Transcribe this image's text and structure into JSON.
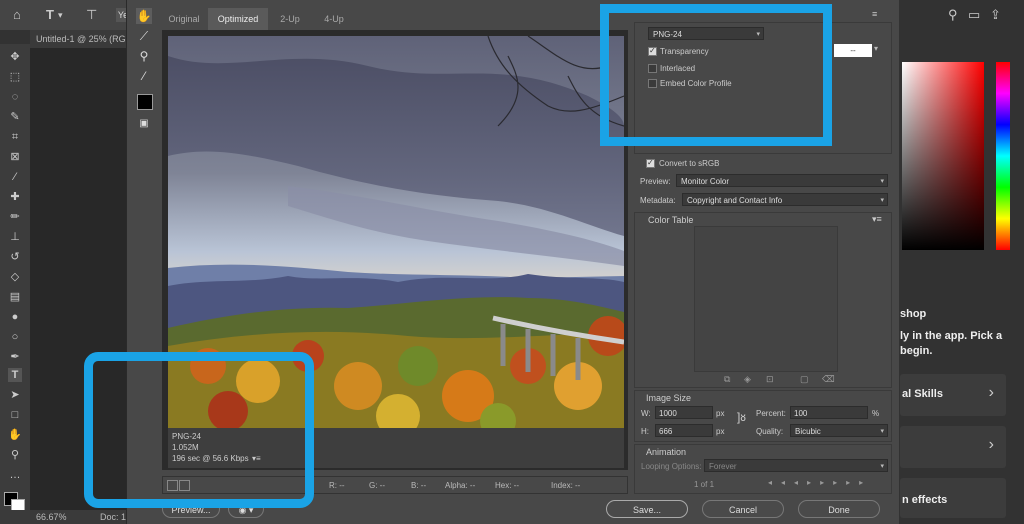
{
  "ps": {
    "top_icons": [
      "home-icon",
      "type-icon",
      "vertical-type-icon"
    ],
    "top_chip": "Ye",
    "doc_tab": "Untitled-1 @ 25% (RG",
    "status_zoom": "66.67%",
    "status_doc": "Doc: 1.",
    "right_top_icons": [
      "search-icon",
      "panels-icon",
      "share-icon"
    ]
  },
  "learn": {
    "heading": "shop",
    "body_line1": "ly in the app. Pick a",
    "body_line2": "begin.",
    "card1_label": "al Skills",
    "card3_label": "n effects"
  },
  "dialog": {
    "tabs": [
      "Original",
      "Optimized",
      "2-Up",
      "4-Up"
    ],
    "active_tab": "Optimized",
    "info_format": "PNG-24",
    "info_size": "1.052M",
    "info_time": "196 sec @ 56.6 Kbps",
    "info_menu": "▾≡",
    "readouts": {
      "r": "R: --",
      "g": "G: --",
      "b": "B: --",
      "alpha": "Alpha: --",
      "hex": "Hex: --",
      "index": "Index: --"
    },
    "buttons": {
      "preview": "Preview...",
      "save": "Save...",
      "cancel": "Cancel",
      "done": "Done"
    }
  },
  "settings": {
    "preset_menu": "≡",
    "format": "PNG-24",
    "transparency": "Transparency",
    "interlaced": "Interlaced",
    "embed_profile": "Embed Color Profile",
    "matte_value": "--",
    "convert_srgb": "Convert to sRGB",
    "preview_label": "Preview:",
    "preview_value": "Monitor Color",
    "metadata_label": "Metadata:",
    "metadata_value": "Copyright and Contact Info",
    "color_table_title": "Color Table",
    "image_size_title": "Image Size",
    "w_label": "W:",
    "w_value": "1000",
    "h_label": "H:",
    "h_value": "666",
    "px": "px",
    "percent_label": "Percent:",
    "percent_value": "100",
    "percent_unit": "%",
    "quality_label": "Quality:",
    "quality_value": "Bicubic",
    "animation_title": "Animation",
    "looping_label": "Looping Options:",
    "looping_value": "Forever",
    "frame_counter": "1 of 1"
  },
  "colors": {
    "highlight": "#1aa3e6",
    "dialog_bg": "#484848",
    "ps_bg": "#323232"
  }
}
